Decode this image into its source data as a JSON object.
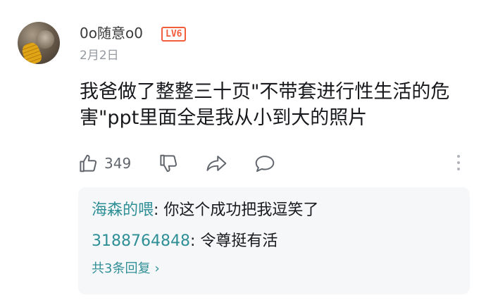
{
  "comment": {
    "username": "0o随意o0",
    "level_badge": "LV6",
    "date": "2月2日",
    "text": "我爸做了整整三十页\"不带套进行性生活的危害\"ppt里面全是我从小到大的照片",
    "likes": "349"
  },
  "icons": {
    "like": "thumbs-up-icon",
    "dislike": "thumbs-down-icon",
    "share": "share-icon",
    "reply": "chat-bubble-icon",
    "more": "more-vertical-icon"
  },
  "colors": {
    "accent": "#2f8f97",
    "badge": "#f25d3b",
    "muted": "#9499a0",
    "reply_bg": "#f6f7f8"
  },
  "replies": {
    "items": [
      {
        "user": "海森的喂",
        "separator": ": ",
        "text": "你这个成功把我逗笑了"
      },
      {
        "user": "3188764848",
        "separator": ": ",
        "text": "令尊挺有活"
      }
    ],
    "expand_label": "共3条回复",
    "expand_chevron": "›"
  }
}
